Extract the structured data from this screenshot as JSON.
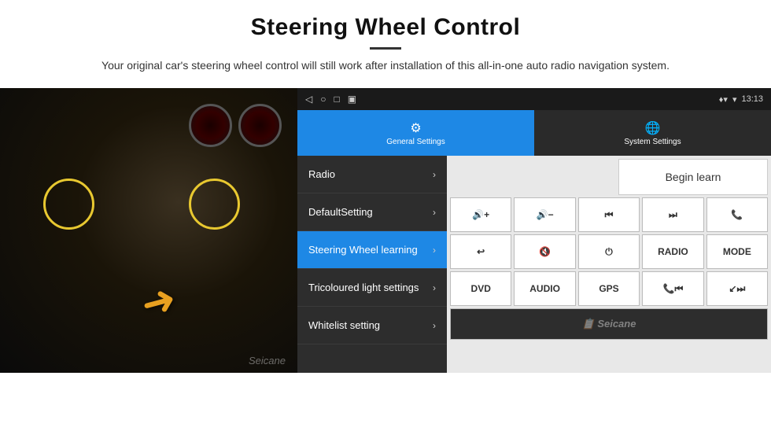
{
  "page": {
    "title": "Steering Wheel Control",
    "divider": "—",
    "subtitle": "Your original car's steering wheel control will still work after installation of this all-in-one auto radio navigation system."
  },
  "status_bar": {
    "time": "13:13",
    "icons": [
      "◁",
      "○",
      "□",
      "▣"
    ]
  },
  "nav_tabs": [
    {
      "id": "general",
      "label": "General Settings",
      "icon": "⚙",
      "active": true
    },
    {
      "id": "system",
      "label": "System Settings",
      "icon": "🌐",
      "active": false
    }
  ],
  "menu_items": [
    {
      "id": "radio",
      "label": "Radio",
      "active": false
    },
    {
      "id": "default",
      "label": "DefaultSetting",
      "active": false
    },
    {
      "id": "steering",
      "label": "Steering Wheel learning",
      "active": true
    },
    {
      "id": "tricoloured",
      "label": "Tricoloured light settings",
      "active": false
    },
    {
      "id": "whitelist",
      "label": "Whitelist setting",
      "active": false
    }
  ],
  "control_panel": {
    "begin_learn": "Begin learn",
    "rows": [
      [
        "🔊+",
        "🔊-",
        "⏮",
        "⏭",
        "📞"
      ],
      [
        "↩",
        "🔇×",
        "⏻",
        "RADIO",
        "MODE"
      ],
      [
        "DVD",
        "AUDIO",
        "GPS",
        "📞⏮",
        "↙⏭"
      ]
    ]
  },
  "watermark": "Seicane",
  "arrow": "➜"
}
